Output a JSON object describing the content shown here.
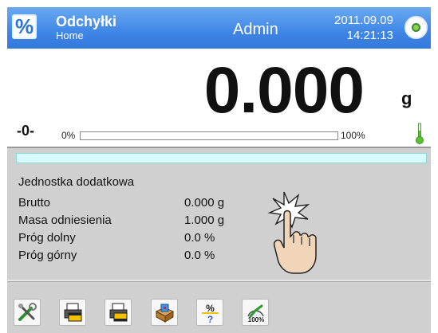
{
  "header": {
    "app_icon": "%",
    "title": "Odchyłki",
    "subtitle": "Home",
    "user": "Admin",
    "date": "2011.09.09",
    "time": "14:21:13",
    "accent_color": "#3f86e6"
  },
  "display": {
    "weight": "0.000",
    "unit": "g",
    "zero_indicator": "-0-",
    "range_min_label": "0%",
    "range_max_label": "100%",
    "load_fraction": 0.0
  },
  "info": {
    "section_label": "Jednostka dodatkowa",
    "rows": [
      {
        "label": "Brutto",
        "value": "0.000 g"
      },
      {
        "label": "Masa odniesienia",
        "value": "1.000 g"
      },
      {
        "label": "Próg dolny",
        "value": "0.0 %"
      },
      {
        "label": "Próg górny",
        "value": "0.0 %"
      }
    ]
  },
  "toolbar": {
    "buttons": [
      {
        "icon": "tools-icon"
      },
      {
        "icon": "printer-header-icon"
      },
      {
        "icon": "printer-footer-icon"
      },
      {
        "icon": "database-box-icon"
      },
      {
        "icon": "percent-question-icon"
      },
      {
        "icon": "reference-mass-100-icon"
      }
    ]
  }
}
